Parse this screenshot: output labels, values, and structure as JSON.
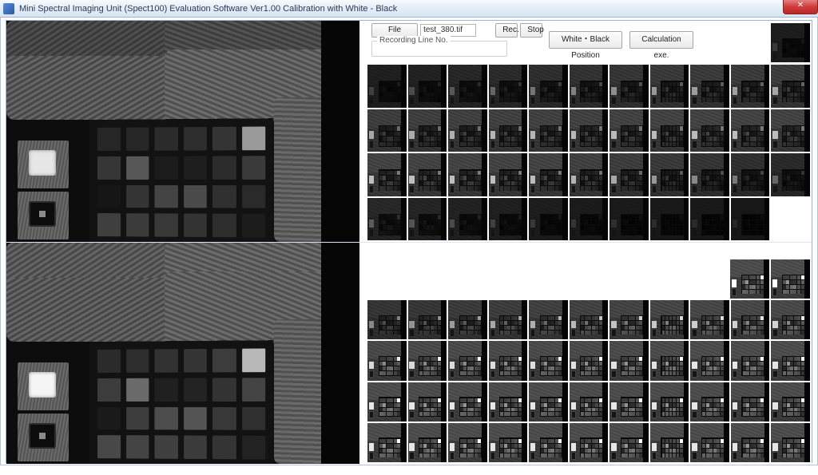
{
  "window": {
    "title": "Mini Spectral Imaging Unit (Spect100) Evaluation Software Ver1.00 Calibration with White - Black",
    "close_glyph": "✕"
  },
  "controls": {
    "file_name_btn": "File Name",
    "file_name_value": "test_380.tif",
    "rec_btn": "Rec.",
    "stop_btn": "Stop",
    "recording_line_label": "Recording Line No.",
    "white_black_btn": "White・Black Position",
    "calc_btn": "Calculation exe."
  },
  "chart_top": {
    "rows": [
      [
        "#262626",
        "#262626",
        "#2b2b2b",
        "#2e2e2e",
        "#343434",
        "#9a9a9a"
      ],
      [
        "#363636",
        "#575757",
        "#1b1b1b",
        "#1e1e1e",
        "#2c2c2c",
        "#3a3a3a"
      ],
      [
        "#161616",
        "#353535",
        "#444444",
        "#4a4a4a",
        "#303030",
        "#2a2a2a"
      ],
      [
        "#3f3f3f",
        "#3b3b3b",
        "#383838",
        "#333333",
        "#2d2d2d",
        "#1c1c1c"
      ]
    ]
  },
  "chart_bottom": {
    "rows": [
      [
        "#2b2b2b",
        "#2d2d2d",
        "#323232",
        "#353535",
        "#3c3c3c",
        "#b8b8b8"
      ],
      [
        "#3c3c3c",
        "#6a6a6a",
        "#202020",
        "#232323",
        "#333333",
        "#444444"
      ],
      [
        "#1a1a1a",
        "#3d3d3d",
        "#4d4d4d",
        "#545454",
        "#383838",
        "#303030"
      ],
      [
        "#484848",
        "#444444",
        "#404040",
        "#3b3b3b",
        "#343434",
        "#222222"
      ]
    ]
  },
  "thumbs_top": {
    "cols": 11,
    "rows": 4,
    "total": 43,
    "brightness_scale": [
      0.18,
      0.22,
      0.28,
      0.34,
      0.4,
      0.46,
      0.52,
      0.58,
      0.6,
      0.62,
      0.65,
      0.66,
      0.68,
      0.7,
      0.72,
      0.73,
      0.74,
      0.75,
      0.76,
      0.76,
      0.77,
      0.77,
      0.78,
      0.78,
      0.78,
      0.77,
      0.76,
      0.72,
      0.66,
      0.58,
      0.5,
      0.42,
      0.34,
      0.3,
      0.26,
      0.22,
      0.18,
      0.15,
      0.13,
      0.11,
      0.1,
      0.09,
      0.08
    ]
  },
  "thumbs_bottom": {
    "cols": 11,
    "rows": 4,
    "total": 44,
    "brightness_scale": [
      0.5,
      0.55,
      0.6,
      0.65,
      0.7,
      0.75,
      0.8,
      0.84,
      0.86,
      0.88,
      0.9,
      0.92,
      0.93,
      0.94,
      0.95,
      0.96,
      0.97,
      0.98,
      0.99,
      1.0,
      1.0,
      1.0,
      1.0,
      1.0,
      1.0,
      1.0,
      1.0,
      1.0,
      1.0,
      1.0,
      1.0,
      1.0,
      1.0,
      1.0,
      1.0,
      1.0,
      1.0,
      1.0,
      1.0,
      1.0,
      1.0,
      1.0,
      1.0,
      1.0
    ]
  },
  "iso_top_count": 1,
  "iso_bottom_count": 2
}
